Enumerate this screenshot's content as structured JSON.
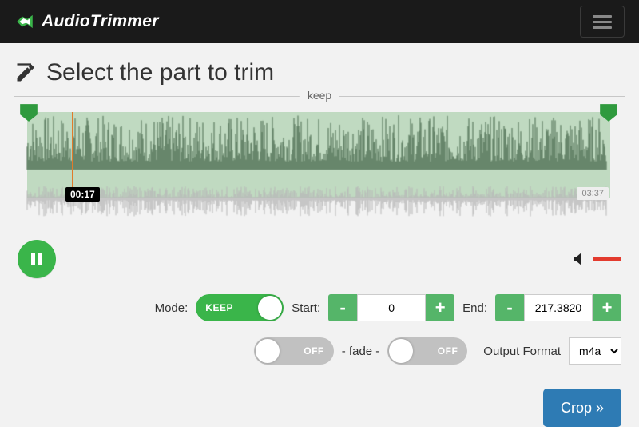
{
  "brand": {
    "name": "AudioTrimmer"
  },
  "title": "Select the part to trim",
  "keep_label": "keep",
  "playback": {
    "current_time": "00:17",
    "total_time": "03:37"
  },
  "mode": {
    "label": "Mode:",
    "active_text": "KEEP"
  },
  "start": {
    "label": "Start:",
    "value": "0"
  },
  "end": {
    "label": "End:",
    "value": "217.3820"
  },
  "fade": {
    "center_label": "- fade -",
    "left_state": "OFF",
    "right_state": "OFF"
  },
  "output": {
    "label": "Output Format",
    "value": "m4a"
  },
  "crop": "Crop »"
}
